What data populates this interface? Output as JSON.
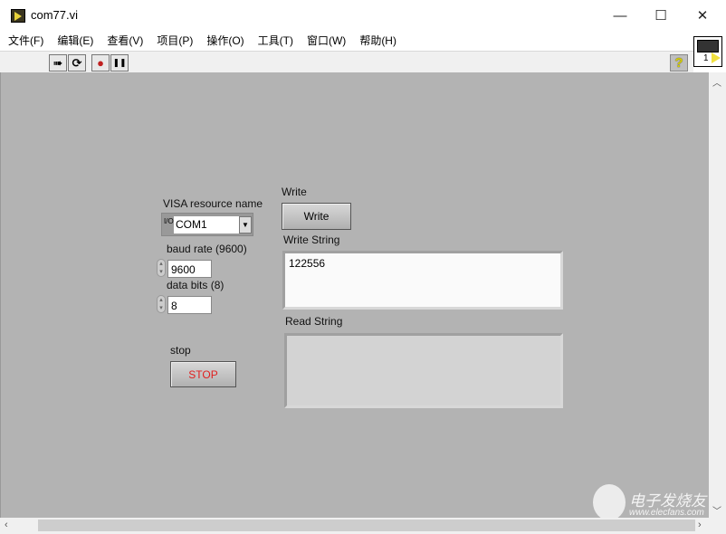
{
  "window": {
    "title": "com77.vi",
    "minimize": "—",
    "maximize": "☐",
    "close": "✕"
  },
  "menu": [
    "文件(F)",
    "编辑(E)",
    "查看(V)",
    "项目(P)",
    "操作(O)",
    "工具(T)",
    "窗口(W)",
    "帮助(H)"
  ],
  "toolbar": {
    "run": "➠",
    "run_continuous": "⟳",
    "abort": "●",
    "pause": "❚❚",
    "help": "?",
    "connector_number": "1"
  },
  "panel": {
    "visa_label": "VISA resource name",
    "visa_io": "I/O",
    "visa_value": "COM1",
    "baud_label": "baud rate (9600)",
    "baud_value": "9600",
    "databits_label": "data bits (8)",
    "databits_value": "8",
    "stop_label": "stop",
    "stop_button": "STOP",
    "write_label": "Write",
    "write_button": "Write",
    "write_string_label": "Write String",
    "write_string_value": "122556",
    "read_string_label": "Read String",
    "read_string_value": ""
  },
  "watermark": {
    "name": "电子发烧友",
    "url": "www.elecfans.com"
  },
  "colors": {
    "panel": "#b3b3b3",
    "stop_text": "#e02020"
  }
}
